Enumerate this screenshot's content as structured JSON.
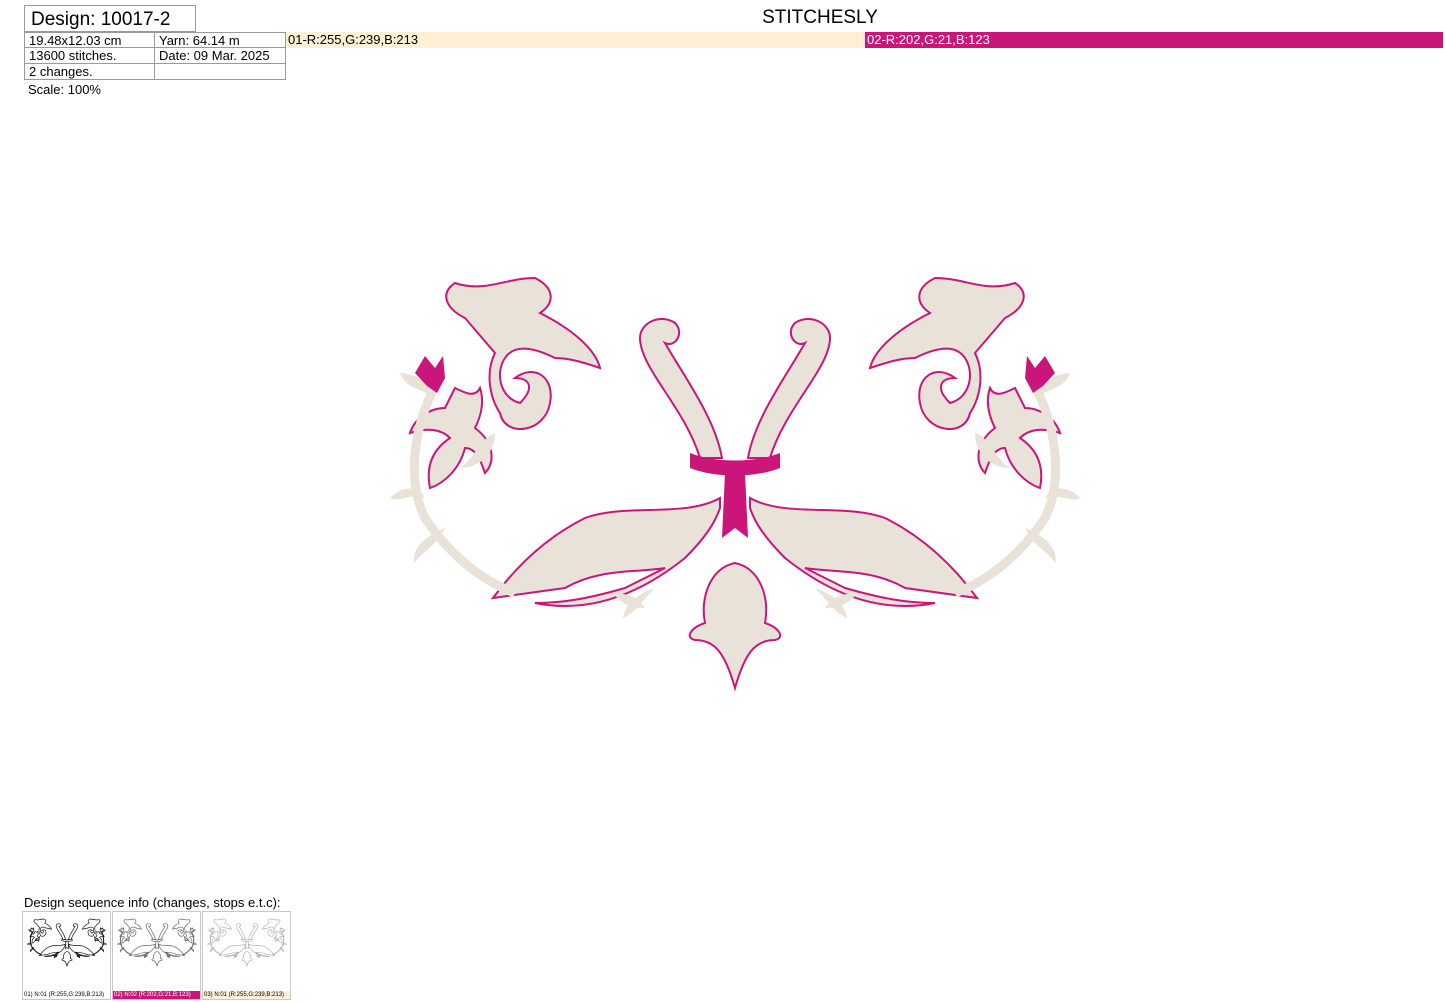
{
  "header": {
    "design_title": "Design: 10017-2",
    "brand": "STITCHESLY",
    "size": "19.48x12.03 cm",
    "yarn": "Yarn: 64.14 m",
    "stitches": "13600 stitches.",
    "date": "Date: 09 Mar. 2025",
    "changes": "2 changes.",
    "scale": "Scale: 100%"
  },
  "colors": [
    {
      "label": "01-R:255,G:239,B:213",
      "hex": "#ffefd5",
      "text_color": "#000000"
    },
    {
      "label": "02-R:202,G:21,B:123",
      "hex": "#ca157b",
      "text_color": "#ffffff"
    }
  ],
  "embroidery": {
    "fill_color": "#e8e2d8",
    "outline_color": "#ca157b",
    "accent_color": "#ca157b"
  },
  "sequence": {
    "title": "Design sequence info (changes, stops e.t.c):",
    "steps": [
      {
        "label": "01) N:01 (R:255,G:239,B:213)",
        "label_bg": "#ffffff",
        "label_color": "#000000",
        "stroke": "#111111"
      },
      {
        "label": "02) N:02 (R:202,G:21,B:123)",
        "label_bg": "#ca157b",
        "label_color": "#ffffff",
        "stroke": "#666666"
      },
      {
        "label": "03) N:01 (R:255,G:239,B:213)",
        "label_bg": "#ffefd5",
        "label_color": "#000000",
        "stroke": "#b4b4b4"
      }
    ]
  }
}
